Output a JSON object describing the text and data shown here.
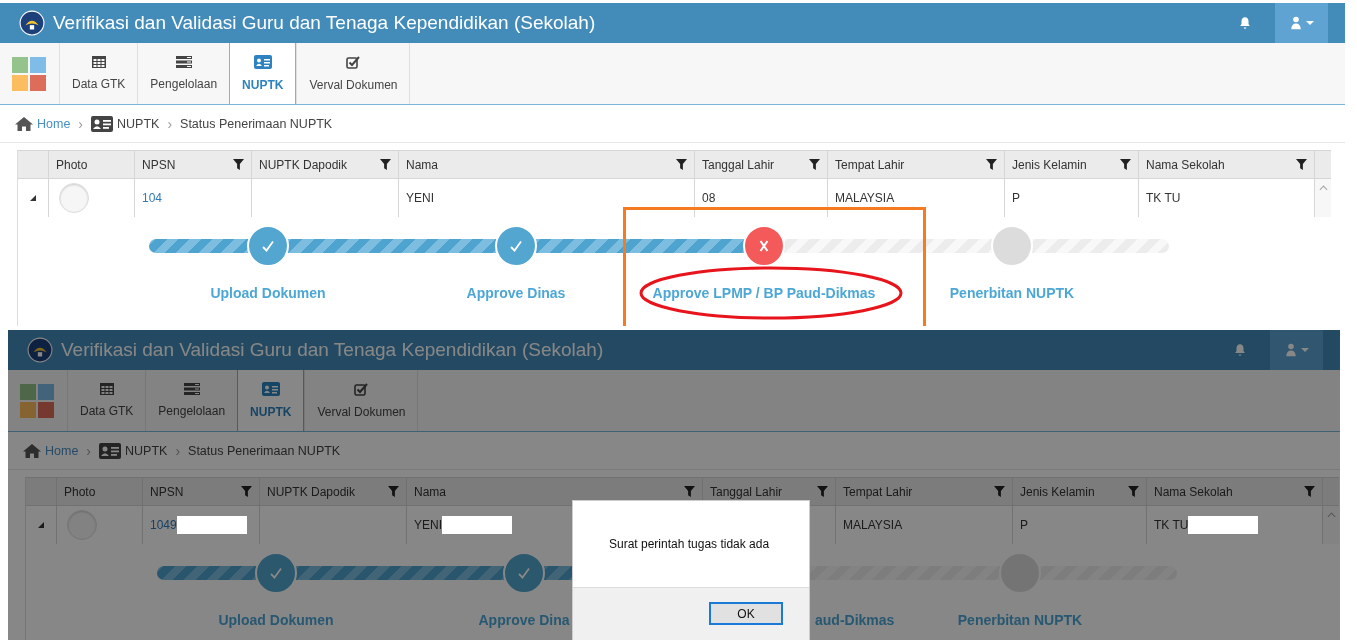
{
  "screens": [
    {
      "app_title": "Verifikasi dan Validasi Guru dan Tenaga Kependidikan (Sekolah)",
      "tabs": [
        {
          "label": "Data GTK",
          "selected": false
        },
        {
          "label": "Pengelolaan",
          "selected": false
        },
        {
          "label": "NUPTK",
          "selected": true
        },
        {
          "label": "Verval Dokumen",
          "selected": false
        }
      ],
      "breadcrumb": [
        {
          "kind": "link",
          "text": "Home"
        },
        {
          "kind": "separator",
          "text": "›"
        },
        {
          "kind": "text",
          "text": "NUPTK"
        },
        {
          "kind": "separator",
          "text": "›"
        },
        {
          "kind": "text",
          "text": "Status Penerimaan NUPTK"
        }
      ],
      "columns": [
        {
          "label": "Photo",
          "filter": false
        },
        {
          "label": "NPSN",
          "filter": true
        },
        {
          "label": "NUPTK Dapodik",
          "filter": true
        },
        {
          "label": "Nama",
          "filter": true
        },
        {
          "label": "Tanggal Lahir",
          "filter": true
        },
        {
          "label": "Tempat Lahir",
          "filter": true
        },
        {
          "label": "Jenis Kelamin",
          "filter": true
        },
        {
          "label": "Nama Sekolah",
          "filter": true
        }
      ],
      "row": {
        "expanded": true,
        "cells": [
          {
            "kind": "avatar"
          },
          {
            "kind": "link",
            "text": "104"
          },
          {
            "kind": "empty"
          },
          {
            "kind": "text",
            "text": "YENI"
          },
          {
            "kind": "text",
            "text": "08"
          },
          {
            "kind": "text",
            "text": "MALAYSIA"
          },
          {
            "kind": "text",
            "text": "P"
          },
          {
            "kind": "text",
            "text": "TK TU"
          }
        ]
      },
      "steps": [
        {
          "label": "Upload Dokumen",
          "kind": "done"
        },
        {
          "label": "Approve Dinas",
          "kind": "done"
        },
        {
          "label": "Approve LPMP / BP Paud-Dikmas",
          "kind": "failed"
        },
        {
          "label": "Penerbitan NUPTK",
          "kind": "pending"
        }
      ],
      "annotations": [
        {
          "kind": "rectangle",
          "color": "#f47b20"
        },
        {
          "kind": "ellipse",
          "color": "#e8141b"
        }
      ]
    },
    {
      "app_title": "Verifikasi dan Validasi Guru dan Tenaga Kependidikan (Sekolah)",
      "tabs": [
        {
          "label": "Data GTK",
          "selected": false
        },
        {
          "label": "Pengelolaan",
          "selected": false
        },
        {
          "label": "NUPTK",
          "selected": true
        },
        {
          "label": "Verval Dokumen",
          "selected": false
        }
      ],
      "breadcrumb": [
        {
          "kind": "link",
          "text": "Home"
        },
        {
          "kind": "separator",
          "text": "›"
        },
        {
          "kind": "text",
          "text": "NUPTK"
        },
        {
          "kind": "separator",
          "text": "›"
        },
        {
          "kind": "text",
          "text": "Status Penerimaan NUPTK"
        }
      ],
      "columns": [
        {
          "label": "Photo",
          "filter": false
        },
        {
          "label": "NPSN",
          "filter": true
        },
        {
          "label": "NUPTK Dapodik",
          "filter": true
        },
        {
          "label": "Nama",
          "filter": true
        },
        {
          "label": "Tanggal Lahir",
          "filter": true
        },
        {
          "label": "Tempat Lahir",
          "filter": true
        },
        {
          "label": "Jenis Kelamin",
          "filter": true
        },
        {
          "label": "Nama Sekolah",
          "filter": true
        }
      ],
      "row": {
        "expanded": true,
        "cells": [
          {
            "kind": "avatar"
          },
          {
            "kind": "link",
            "text": "1049",
            "redacted": true
          },
          {
            "kind": "empty"
          },
          {
            "kind": "text",
            "text": "YENI",
            "redacted": true
          },
          {
            "kind": "empty"
          },
          {
            "kind": "text",
            "text": "MALAYSIA"
          },
          {
            "kind": "text",
            "text": "P"
          },
          {
            "kind": "text",
            "text": "TK TU",
            "redacted": true
          }
        ]
      },
      "steps": [
        {
          "label": "Upload Dokumen",
          "kind": "done"
        },
        {
          "label": "Approve Dina",
          "kind": "done"
        },
        {
          "label": "aud-Dikmas",
          "kind": "covered"
        },
        {
          "label": "Penerbitan NUPTK",
          "kind": "pending"
        }
      ],
      "dialog": {
        "message": "Surat perintah tugas tidak ada",
        "button": "OK"
      }
    }
  ]
}
